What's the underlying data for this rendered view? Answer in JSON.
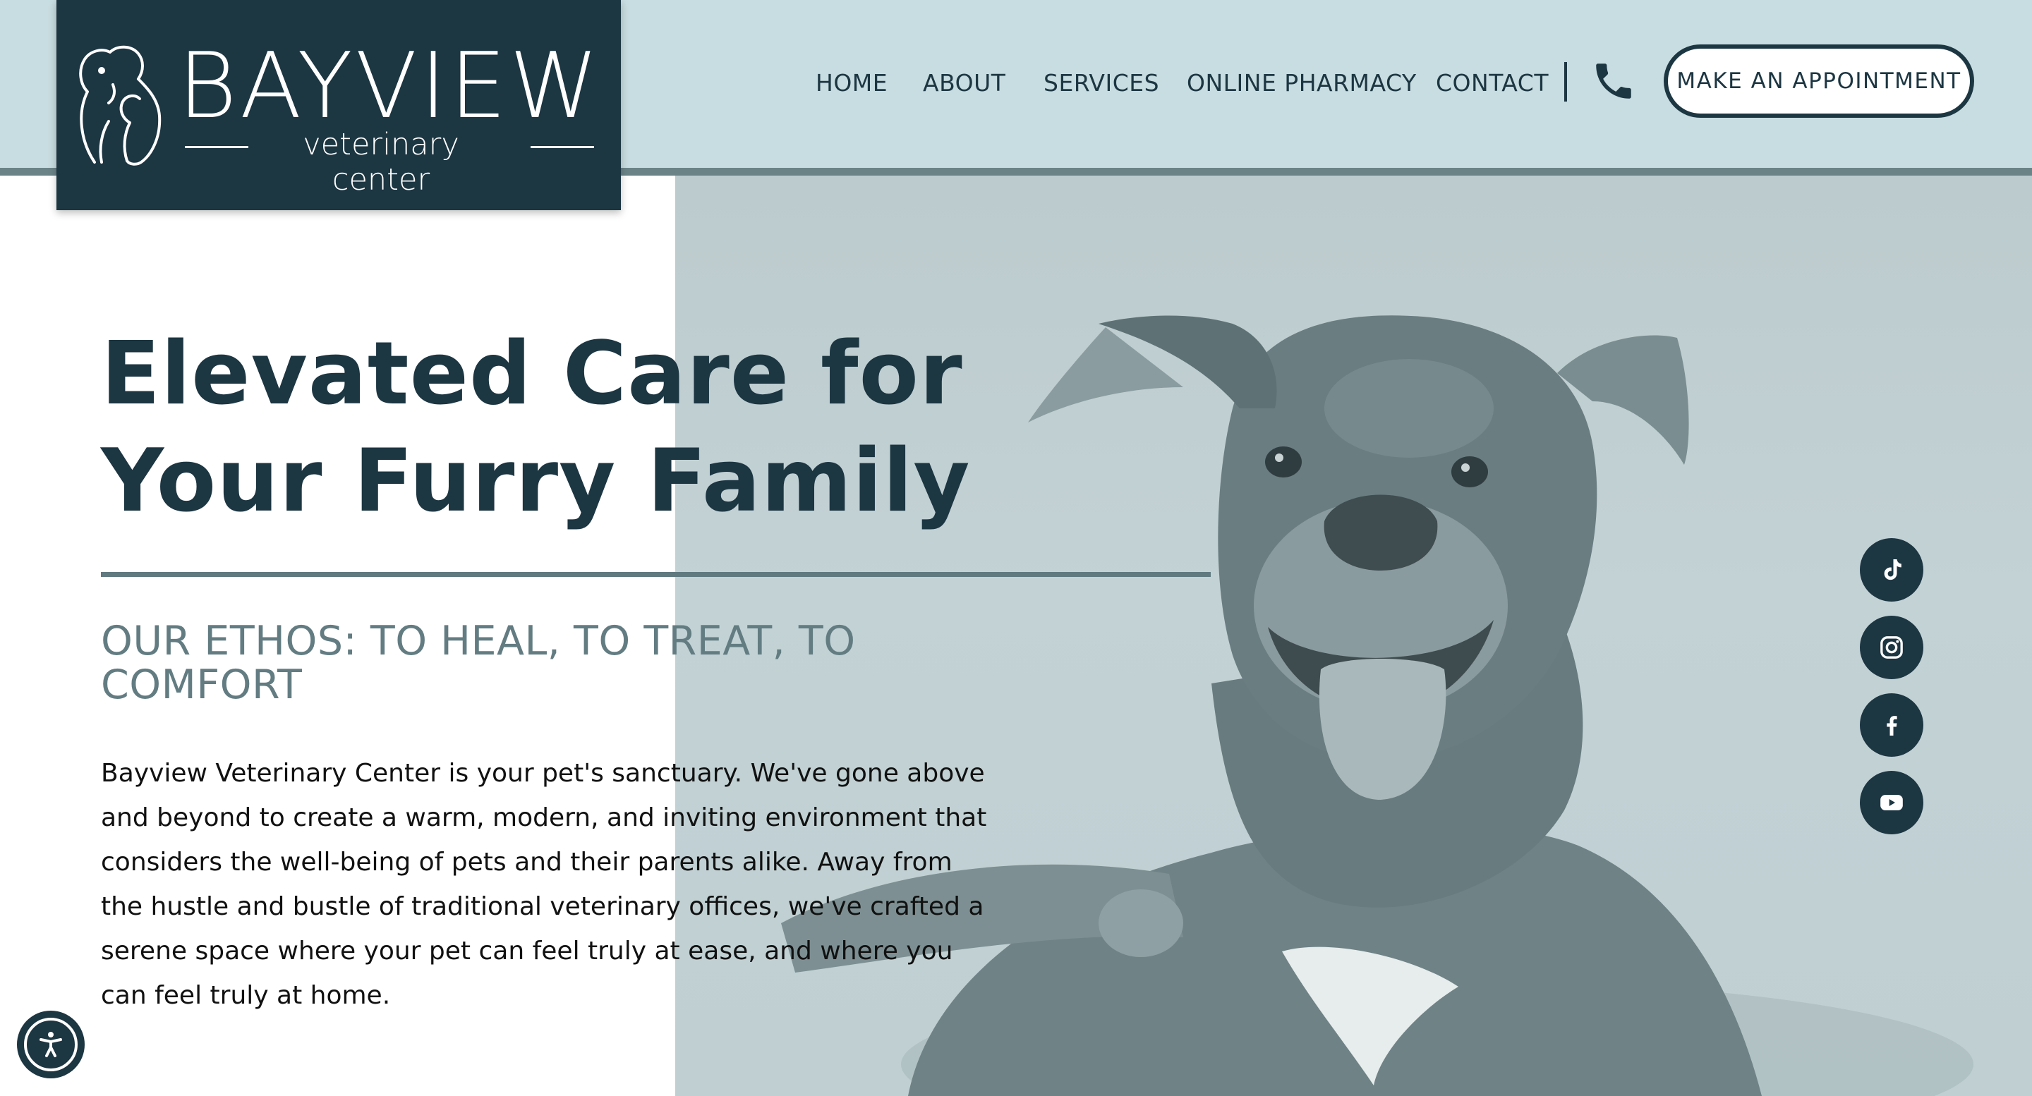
{
  "colors": {
    "brand_dark": "#1c3642",
    "header_bg": "#c8dde1",
    "header_rule": "#6b8387",
    "ethos_text": "#627c82",
    "hero_tint": "#bfcfd2"
  },
  "logo": {
    "wordmark": "BAYVIEW",
    "subtitle": "veterinary center",
    "icon": "dog-cat-outline-logo-icon"
  },
  "nav": {
    "items": [
      {
        "label": "HOME"
      },
      {
        "label": "ABOUT"
      },
      {
        "label": "SERVICES"
      },
      {
        "label": "ONLINE PHARMACY"
      },
      {
        "label": "CONTACT"
      }
    ],
    "phone_icon": "phone-icon",
    "cta_label": "MAKE AN APPOINTMENT"
  },
  "hero": {
    "title_line1": "Elevated Care for",
    "title_line2": "Your Furry Family",
    "ethos": "OUR ETHOS: TO HEAL, TO TREAT, TO COMFORT",
    "intro": "Bayview Veterinary Center is your pet's sanctuary. We've gone above and beyond to create a warm, modern, and inviting environment that considers the well-being of pets and their parents alike. Away from the hustle and bustle of traditional veterinary offices, we've crafted a serene space where your pet can feel truly at ease, and where you can feel truly at home.",
    "image": "dog-photo"
  },
  "social": [
    {
      "icon": "tiktok-icon"
    },
    {
      "icon": "instagram-icon"
    },
    {
      "icon": "facebook-icon"
    },
    {
      "icon": "youtube-icon"
    }
  ],
  "accessibility": {
    "icon": "accessibility-icon"
  }
}
